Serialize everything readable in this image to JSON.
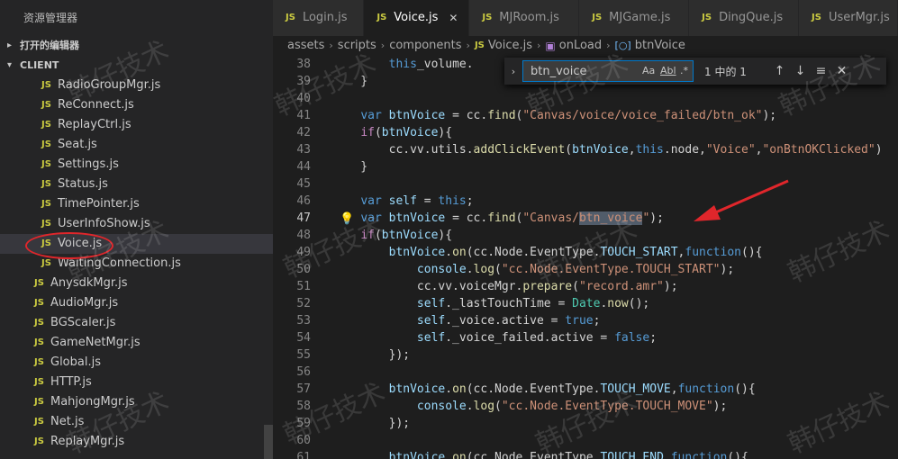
{
  "sidebar": {
    "title": "资源管理器",
    "open_editors_label": "打开的编辑器",
    "folder_label": "CLIENT",
    "items": [
      {
        "name": "RadioGroupMgr.js",
        "level": 3
      },
      {
        "name": "ReConnect.js",
        "level": 3
      },
      {
        "name": "ReplayCtrl.js",
        "level": 3
      },
      {
        "name": "Seat.js",
        "level": 3
      },
      {
        "name": "Settings.js",
        "level": 3
      },
      {
        "name": "Status.js",
        "level": 3
      },
      {
        "name": "TimePointer.js",
        "level": 3
      },
      {
        "name": "UserInfoShow.js",
        "level": 3
      },
      {
        "name": "Voice.js",
        "level": 3,
        "selected": true
      },
      {
        "name": "WaitingConnection.js",
        "level": 3
      },
      {
        "name": "AnysdkMgr.js",
        "level": 2
      },
      {
        "name": "AudioMgr.js",
        "level": 2
      },
      {
        "name": "BGScaler.js",
        "level": 2
      },
      {
        "name": "GameNetMgr.js",
        "level": 2
      },
      {
        "name": "Global.js",
        "level": 2
      },
      {
        "name": "HTTP.js",
        "level": 2
      },
      {
        "name": "MahjongMgr.js",
        "level": 2
      },
      {
        "name": "Net.js",
        "level": 2
      },
      {
        "name": "ReplayMgr.js",
        "level": 2
      }
    ]
  },
  "file_badge": "JS",
  "tabs": [
    {
      "label": "Login.js",
      "active": false
    },
    {
      "label": "Voice.js",
      "active": true
    },
    {
      "label": "MJRoom.js",
      "active": false
    },
    {
      "label": "MJGame.js",
      "active": false
    },
    {
      "label": "DingQue.js",
      "active": false
    },
    {
      "label": "UserMgr.js",
      "active": false
    }
  ],
  "breadcrumb": [
    "assets",
    "scripts",
    "components",
    "Voice.js",
    "onLoad",
    "btnVoice"
  ],
  "find": {
    "query": "btn_voice",
    "options": [
      "Aa",
      "Abl",
      ".*"
    ],
    "result": "1 中的 1"
  },
  "code": [
    {
      "n": "38",
      "tokens": [
        [
          "",
          "        "
        ],
        [
          "kw",
          "this"
        ],
        [
          "",
          ".",
          "_volume."
        ]
      ]
    },
    {
      "n": "39",
      "tokens": [
        [
          "",
          "    }"
        ]
      ]
    },
    {
      "n": "40",
      "tokens": [
        [
          "",
          ""
        ]
      ]
    },
    {
      "n": "41",
      "tokens": [
        [
          "",
          "    "
        ],
        [
          "kw",
          "var"
        ],
        [
          "",
          " "
        ],
        [
          "var",
          "btnVoice"
        ],
        [
          "",
          " = cc."
        ],
        [
          "fn",
          "find"
        ],
        [
          "",
          "("
        ],
        [
          "str",
          "\"Canvas/voice/voice_failed/btn_ok\""
        ],
        [
          "",
          ");"
        ]
      ]
    },
    {
      "n": "42",
      "tokens": [
        [
          "",
          "    "
        ],
        [
          "ctl",
          "if"
        ],
        [
          "",
          "("
        ],
        [
          "var",
          "btnVoice"
        ],
        [
          "",
          "){"
        ]
      ]
    },
    {
      "n": "43",
      "tokens": [
        [
          "",
          "        cc.vv.utils."
        ],
        [
          "fn",
          "addClickEvent"
        ],
        [
          "",
          "("
        ],
        [
          "var",
          "btnVoice"
        ],
        [
          "",
          ","
        ],
        [
          "kw",
          "this"
        ],
        [
          "",
          ".node,"
        ],
        [
          "str",
          "\"Voice\""
        ],
        [
          "",
          ","
        ],
        [
          "str",
          "\"onBtnOKClicked\""
        ],
        [
          "",
          ")"
        ]
      ]
    },
    {
      "n": "44",
      "tokens": [
        [
          "",
          "    }"
        ]
      ]
    },
    {
      "n": "45",
      "tokens": [
        [
          "",
          ""
        ]
      ]
    },
    {
      "n": "46",
      "tokens": [
        [
          "",
          "    "
        ],
        [
          "kw",
          "var"
        ],
        [
          "",
          " "
        ],
        [
          "var",
          "self"
        ],
        [
          "",
          " = "
        ],
        [
          "kw",
          "this"
        ],
        [
          "",
          ";"
        ]
      ]
    },
    {
      "n": "47",
      "tokens": [
        [
          "",
          "    "
        ],
        [
          "kw",
          "var"
        ],
        [
          "",
          " "
        ],
        [
          "var",
          "btnVoice"
        ],
        [
          "",
          " = cc."
        ],
        [
          "fn",
          "find"
        ],
        [
          "",
          "("
        ],
        [
          "str",
          "\"Canvas/"
        ],
        [
          "str hl",
          "btn_voice"
        ],
        [
          "str",
          "\""
        ],
        [
          "",
          ");"
        ]
      ]
    },
    {
      "n": "48",
      "tokens": [
        [
          "",
          "    "
        ],
        [
          "ctl",
          "if"
        ],
        [
          "",
          "("
        ],
        [
          "var",
          "btnVoice"
        ],
        [
          "",
          "){"
        ]
      ]
    },
    {
      "n": "49",
      "tokens": [
        [
          "",
          "        "
        ],
        [
          "var",
          "btnVoice"
        ],
        [
          "",
          "."
        ],
        [
          "fn",
          "on"
        ],
        [
          "",
          "(cc.Node.EventType."
        ],
        [
          "var",
          "TOUCH_START"
        ],
        [
          "",
          ","
        ],
        [
          "kw",
          "function"
        ],
        [
          "",
          "(){"
        ]
      ]
    },
    {
      "n": "50",
      "tokens": [
        [
          "",
          "            "
        ],
        [
          "var",
          "console"
        ],
        [
          "",
          "."
        ],
        [
          "fn",
          "log"
        ],
        [
          "",
          "("
        ],
        [
          "str",
          "\"cc.Node.EventType.TOUCH_START\""
        ],
        [
          "",
          ");"
        ]
      ]
    },
    {
      "n": "51",
      "tokens": [
        [
          "",
          "            cc.vv.voiceMgr."
        ],
        [
          "fn",
          "prepare"
        ],
        [
          "",
          "("
        ],
        [
          "str",
          "\"record.amr\""
        ],
        [
          "",
          ");"
        ]
      ]
    },
    {
      "n": "52",
      "tokens": [
        [
          "",
          "            "
        ],
        [
          "var",
          "self"
        ],
        [
          "",
          "._lastTouchTime = "
        ],
        [
          "cls",
          "Date"
        ],
        [
          "",
          "."
        ],
        [
          "fn",
          "now"
        ],
        [
          "",
          "();"
        ]
      ]
    },
    {
      "n": "53",
      "tokens": [
        [
          "",
          "            "
        ],
        [
          "var",
          "self"
        ],
        [
          "",
          "._voice.active = "
        ],
        [
          "kw",
          "true"
        ],
        [
          "",
          ";"
        ]
      ]
    },
    {
      "n": "54",
      "tokens": [
        [
          "",
          "            "
        ],
        [
          "var",
          "self"
        ],
        [
          "",
          "._voice_failed.active = "
        ],
        [
          "kw",
          "false"
        ],
        [
          "",
          ";"
        ]
      ]
    },
    {
      "n": "55",
      "tokens": [
        [
          "",
          "        });"
        ]
      ]
    },
    {
      "n": "56",
      "tokens": [
        [
          "",
          ""
        ]
      ]
    },
    {
      "n": "57",
      "tokens": [
        [
          "",
          "        "
        ],
        [
          "var",
          "btnVoice"
        ],
        [
          "",
          "."
        ],
        [
          "fn",
          "on"
        ],
        [
          "",
          "(cc.Node.EventType."
        ],
        [
          "var",
          "TOUCH_MOVE"
        ],
        [
          "",
          ","
        ],
        [
          "kw",
          "function"
        ],
        [
          "",
          "(){"
        ]
      ]
    },
    {
      "n": "58",
      "tokens": [
        [
          "",
          "            "
        ],
        [
          "var",
          "console"
        ],
        [
          "",
          "."
        ],
        [
          "fn",
          "log"
        ],
        [
          "",
          "("
        ],
        [
          "str",
          "\"cc.Node.EventType.TOUCH_MOVE\""
        ],
        [
          "",
          ");"
        ]
      ]
    },
    {
      "n": "59",
      "tokens": [
        [
          "",
          "        });"
        ]
      ]
    },
    {
      "n": "60",
      "tokens": [
        [
          "",
          ""
        ]
      ]
    },
    {
      "n": "61",
      "tokens": [
        [
          "",
          "        "
        ],
        [
          "var",
          "btnVoice"
        ],
        [
          "",
          "."
        ],
        [
          "fn",
          "on"
        ],
        [
          "",
          "(cc.Node.EventType."
        ],
        [
          "var",
          "TOUCH_END"
        ],
        [
          "",
          ","
        ],
        [
          "kw",
          "function"
        ],
        [
          "",
          "(){"
        ]
      ]
    }
  ],
  "current_line": "47",
  "watermark": "韩仔技术",
  "colors": {
    "accent": "#007acc",
    "annotation_red": "#e0262b",
    "js_badge": "#cbcb41"
  }
}
